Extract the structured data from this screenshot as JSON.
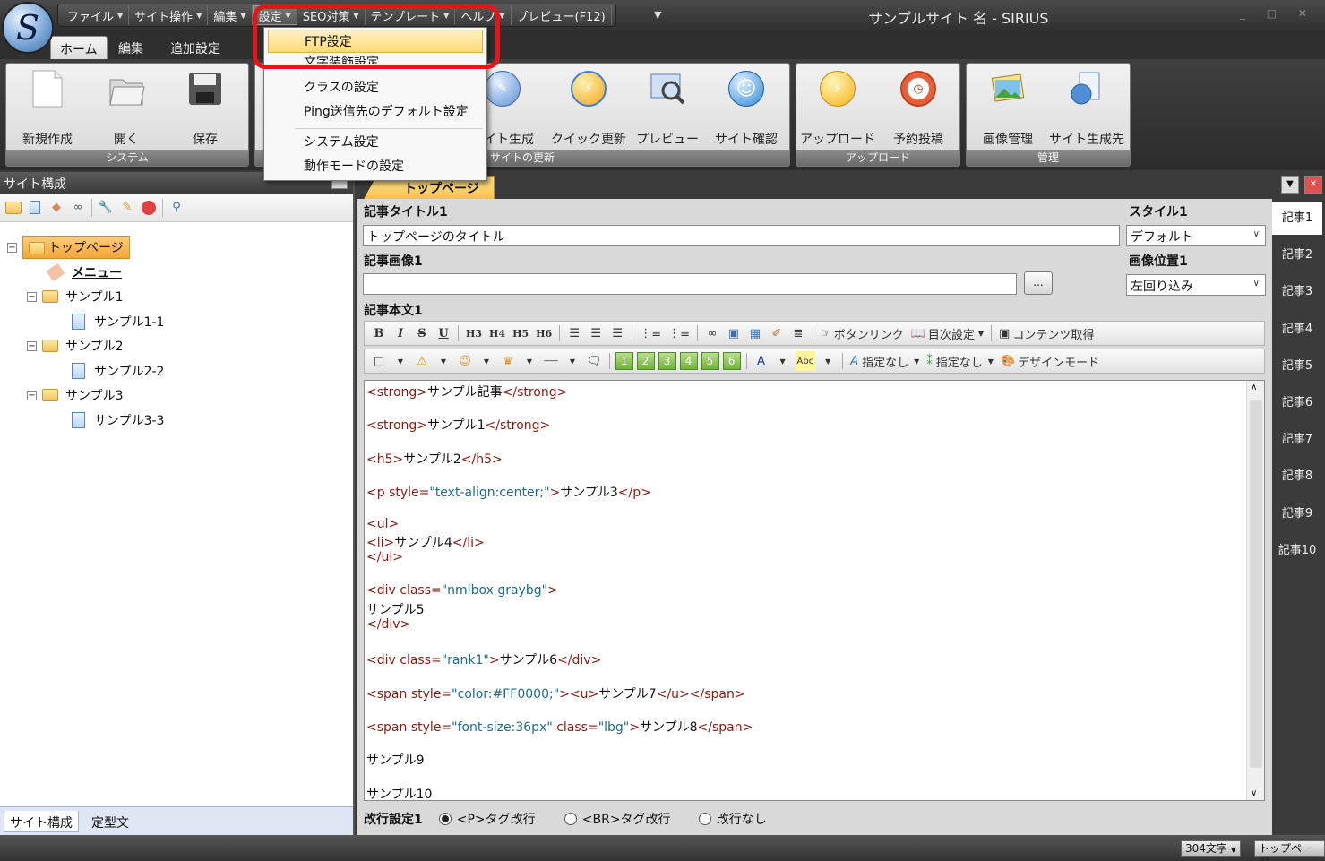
{
  "app": {
    "window_title": "サンプルサイト 名 - SIRIUS",
    "logo_glyph": "S"
  },
  "quick_access": [
    {
      "label": "ファイル",
      "dropdown": true
    },
    {
      "label": "サイト操作",
      "dropdown": true
    },
    {
      "label": "編集",
      "dropdown": true
    },
    {
      "label": "設定",
      "dropdown": true,
      "active": true
    },
    {
      "label": "SEO対策",
      "dropdown": true
    },
    {
      "label": "テンプレート",
      "dropdown": true
    },
    {
      "label": "ヘルプ",
      "dropdown": true
    },
    {
      "label": "プレビュー(F12)",
      "dropdown": false
    }
  ],
  "ribbon_tabs": [
    "ホーム",
    "編集",
    "追加設定"
  ],
  "ribbon_groups": [
    {
      "label": "システム",
      "buttons": [
        {
          "label": "新規作成",
          "icon": "new-document-icon"
        },
        {
          "label": "開く",
          "icon": "open-folder-icon"
        },
        {
          "label": "保存",
          "icon": "save-disk-icon"
        }
      ]
    },
    {
      "label": "サイトの更新",
      "buttons": [
        {
          "label": "サイト生成",
          "icon": "generate-site-icon"
        },
        {
          "label": "クイック更新",
          "icon": "quick-update-icon"
        },
        {
          "label": "プレビュー",
          "icon": "preview-icon"
        },
        {
          "label": "サイト確認",
          "icon": "site-check-icon"
        }
      ]
    },
    {
      "label": "アップロード",
      "buttons": [
        {
          "label": "アップロード",
          "icon": "upload-icon"
        },
        {
          "label": "予約投稿",
          "icon": "scheduled-post-icon"
        }
      ]
    },
    {
      "label": "管理",
      "buttons": [
        {
          "label": "画像管理",
          "icon": "image-manage-icon"
        },
        {
          "label": "サイト生成先",
          "icon": "output-location-icon"
        }
      ]
    }
  ],
  "settings_menu": {
    "items": [
      "FTP設定",
      "文字装飾設定",
      "クラスの設定",
      "Ping送信先のデフォルト設定",
      "システム設定",
      "動作モードの設定"
    ],
    "highlighted": "FTP設定"
  },
  "left_panel": {
    "title": "サイト構成",
    "tree": {
      "root": "トップページ",
      "menu": "メニュー",
      "folders": [
        {
          "label": "サンプル1",
          "page": "サンプル1-1"
        },
        {
          "label": "サンプル2",
          "page": "サンプル2-2"
        },
        {
          "label": "サンプル3",
          "page": "サンプル3-3"
        }
      ]
    },
    "bottom_tabs": [
      "サイト構成",
      "定型文"
    ]
  },
  "editor": {
    "doc_tab": "トップページ",
    "title_label": "記事タイトル1",
    "title_value": "トップページのタイトル",
    "image_label": "記事画像1",
    "image_value": "",
    "browse_label": "...",
    "style_label": "スタイル1",
    "style_value": "デフォルト",
    "image_pos_label": "画像位置1",
    "image_pos_value": "左回り込み",
    "body_label": "記事本文1",
    "toolbar1": {
      "bold": "B",
      "italic": "I",
      "strike": "S",
      "underline": "U",
      "h3": "H3",
      "h4": "H4",
      "h5": "H5",
      "h6": "H6",
      "button_link": "ボタンリンク",
      "toc": "目次設定",
      "fetch": "コンテンツ取得"
    },
    "toolbar2": {
      "numbers": [
        "1",
        "2",
        "3",
        "4",
        "5",
        "6"
      ],
      "font_color": "A",
      "highlight": "Abc",
      "font_none": "指定なし",
      "class_none": "指定なし",
      "design_mode": "デザインモード"
    },
    "code_lines": [
      [
        [
          "t",
          "<strong>"
        ],
        [
          "x",
          "サンプル記事"
        ],
        [
          "t",
          "</strong>"
        ]
      ],
      [],
      [
        [
          "t",
          "<strong>"
        ],
        [
          "x",
          "サンプル1"
        ],
        [
          "t",
          "</strong>"
        ]
      ],
      [],
      [
        [
          "t",
          "<h5>"
        ],
        [
          "x",
          "サンプル2"
        ],
        [
          "t",
          "</h5>"
        ]
      ],
      [],
      [
        [
          "t",
          "<p style="
        ],
        [
          "a",
          "\"text-align:center;\""
        ],
        [
          "t",
          ">"
        ],
        [
          "x",
          "サンプル3"
        ],
        [
          "t",
          "</p>"
        ]
      ],
      [],
      [
        [
          "t",
          "<ul>"
        ]
      ],
      [
        [
          "t",
          "<li>"
        ],
        [
          "x",
          "サンプル4"
        ],
        [
          "t",
          "</li>"
        ]
      ],
      [
        [
          "t",
          "</ul>"
        ]
      ],
      [],
      [
        [
          "t",
          "<div class="
        ],
        [
          "a",
          "\"nmlbox graybg\""
        ],
        [
          "t",
          ">"
        ]
      ],
      [
        [
          "x",
          "サンプル5"
        ]
      ],
      [
        [
          "t",
          "</div>"
        ]
      ],
      [],
      [
        [
          "t",
          "<div class="
        ],
        [
          "a",
          "\"rank1\""
        ],
        [
          "t",
          ">"
        ],
        [
          "x",
          "サンプル6"
        ],
        [
          "t",
          "</div>"
        ]
      ],
      [],
      [
        [
          "t",
          "<span style="
        ],
        [
          "a",
          "\"color:#FF0000;\""
        ],
        [
          "t",
          "><u>"
        ],
        [
          "x",
          "サンプル7"
        ],
        [
          "t",
          "</u></span>"
        ]
      ],
      [],
      [
        [
          "t",
          "<span style="
        ],
        [
          "a",
          "\"font-size:36px\""
        ],
        [
          "t",
          " class="
        ],
        [
          "a",
          "\"lbg\""
        ],
        [
          "t",
          ">"
        ],
        [
          "x",
          "サンプル8"
        ],
        [
          "t",
          "</span>"
        ]
      ],
      [],
      [
        [
          "x",
          "サンプル9"
        ]
      ],
      [],
      [
        [
          "x",
          "サンプル10"
        ]
      ]
    ],
    "linebreak": {
      "label": "改行設定1",
      "options": [
        "<P>タグ改行",
        "<BR>タグ改行",
        "改行なし"
      ],
      "selected": 0
    }
  },
  "article_tabs": [
    "記事1",
    "記事2",
    "記事3",
    "記事4",
    "記事5",
    "記事6",
    "記事7",
    "記事8",
    "記事9",
    "記事10"
  ],
  "status": {
    "char_count": "304文字",
    "page": "トップページ"
  }
}
